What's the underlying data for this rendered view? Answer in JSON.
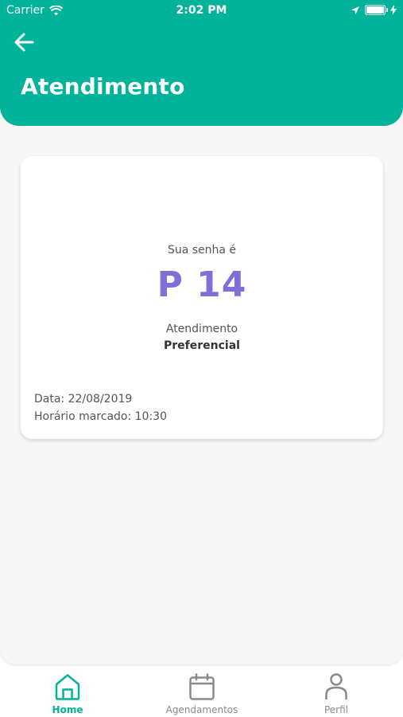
{
  "status_bar": {
    "carrier": "Carrier",
    "time": "2:02 PM",
    "icons": [
      "wifi-icon",
      "location-arrow-icon",
      "battery-icon",
      "charging-bolt-icon"
    ]
  },
  "header": {
    "back_icon": "arrow-left-icon",
    "title": "Atendimento",
    "color": "#00b39a"
  },
  "ticket": {
    "intro": "Sua senha é",
    "number": "P 14",
    "number_color": "#7f6fd6",
    "service_label": "Atendimento",
    "service_type": "Preferencial",
    "date": "Data: 22/08/2019",
    "time": "Horário marcado: 10:30"
  },
  "bottom_nav": {
    "active": "home",
    "items": [
      {
        "id": "home",
        "label": "Home",
        "icon": "home-icon"
      },
      {
        "id": "agendamentos",
        "label": "Agendamentos",
        "icon": "calendar-icon"
      },
      {
        "id": "perfil",
        "label": "Perfil",
        "icon": "user-icon"
      }
    ]
  }
}
